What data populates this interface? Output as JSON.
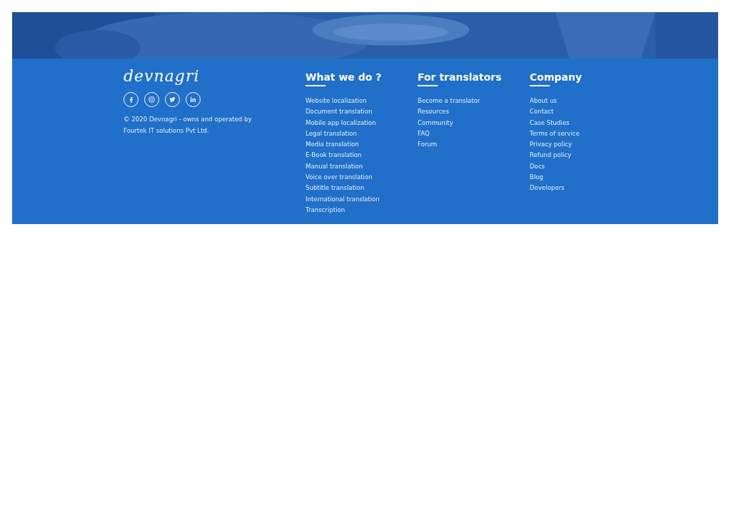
{
  "footer": {
    "brand": "devnagri",
    "social": [
      {
        "kind": "facebook"
      },
      {
        "kind": "instagram"
      },
      {
        "kind": "twitter"
      },
      {
        "kind": "linkedin"
      }
    ],
    "copyright": "© 2020 Devnagri - owns and operated by Fourtek IT solutions Pvt Ltd.",
    "columns": [
      {
        "heading": "What we do ?",
        "links": [
          "Website localization",
          "Document translation",
          "Mobile app localization",
          "Legal translation",
          "Media translation",
          "E-Book translation",
          "Manual translation",
          "Voice over translation",
          "Subtitle translation",
          "International translation",
          "Transcription"
        ]
      },
      {
        "heading": "For translators",
        "links": [
          "Become a translator",
          "Resources",
          "Community",
          "FAQ",
          "Forum"
        ]
      },
      {
        "heading": "Company",
        "links": [
          "About us",
          "Contact",
          "Case Studies",
          "Terms of service",
          "Privacy policy",
          "Refund policy",
          "Docs",
          "Blog",
          "Developers"
        ]
      }
    ]
  }
}
